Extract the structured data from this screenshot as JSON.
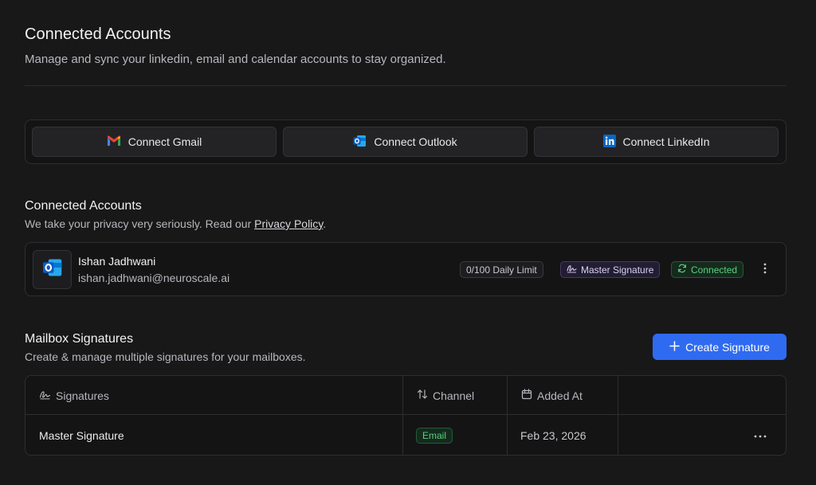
{
  "header": {
    "title": "Connected Accounts",
    "subtitle": "Manage and sync your linkedin, email and calendar accounts to stay organized."
  },
  "connect": {
    "gmail_label": "Connect Gmail",
    "outlook_label": "Connect Outlook",
    "linkedin_label": "Connect LinkedIn"
  },
  "accounts_section": {
    "title": "Connected Accounts",
    "privacy_prefix": "We take your privacy very seriously. Read our ",
    "privacy_link": "Privacy Policy",
    "privacy_suffix": "."
  },
  "account": {
    "name": "Ishan Jadhwani",
    "email": "ishan.jadhwani@neuroscale.ai",
    "daily_limit": "0/100 Daily Limit",
    "signature_badge": "Master Signature",
    "status": "Connected",
    "provider_icon": "outlook-icon"
  },
  "signatures_section": {
    "title": "Mailbox Signatures",
    "subtitle": "Create & manage multiple signatures for your mailboxes.",
    "create_label": "Create Signature"
  },
  "table": {
    "columns": [
      "Signatures",
      "Channel",
      "Added At"
    ],
    "rows": [
      {
        "name": "Master Signature",
        "channel": "Email",
        "added_at": "Feb 23, 2026"
      }
    ]
  },
  "colors": {
    "background": "#181819",
    "accent": "#2f6bf1",
    "connected_green": "#58d17e",
    "signature_purple": "#d8d2ef"
  }
}
